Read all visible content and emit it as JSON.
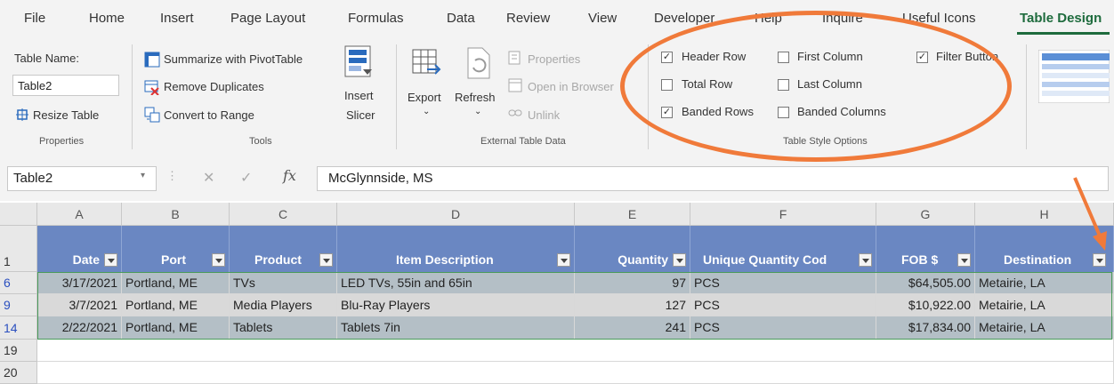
{
  "tabs": [
    "File",
    "Home",
    "Insert",
    "Page Layout",
    "Formulas",
    "Data",
    "Review",
    "View",
    "Developer",
    "Help",
    "Inquire",
    "Useful Icons",
    "Table Design"
  ],
  "ribbon": {
    "properties": {
      "table_name_label": "Table Name:",
      "table_name_value": "Table2",
      "resize": "Resize Table",
      "group": "Properties"
    },
    "tools": {
      "summarize": "Summarize with PivotTable",
      "remove_dups": "Remove Duplicates",
      "convert": "Convert to Range",
      "insert_slicer_1": "Insert",
      "insert_slicer_2": "Slicer",
      "group": "Tools"
    },
    "external": {
      "export": "Export",
      "refresh": "Refresh",
      "properties": "Properties",
      "open_browser": "Open in Browser",
      "unlink": "Unlink",
      "group": "External Table Data"
    },
    "style_options": {
      "header_row": "Header Row",
      "total_row": "Total Row",
      "banded_rows": "Banded Rows",
      "first_column": "First Column",
      "last_column": "Last Column",
      "banded_columns": "Banded Columns",
      "filter_button": "Filter Button",
      "group": "Table Style Options",
      "checks": {
        "header_row": true,
        "total_row": false,
        "banded_rows": true,
        "first_column": false,
        "last_column": false,
        "banded_columns": false,
        "filter_button": true
      }
    }
  },
  "formula_bar": {
    "name_box": "Table2",
    "fx": "fx",
    "value": "McGlynnside, MS"
  },
  "columns": [
    "A",
    "B",
    "C",
    "D",
    "E",
    "F",
    "G",
    "H"
  ],
  "headers": [
    "Date",
    "Port",
    "Product",
    "Item Description",
    "Quantity",
    "Unique Quantity Cod",
    "FOB $",
    "Destination"
  ],
  "row_numbers": [
    "1",
    "6",
    "9",
    "14",
    "19",
    "20"
  ],
  "rows": [
    [
      "3/17/2021",
      "Portland, ME",
      "TVs",
      "LED TVs, 55in and 65in",
      "97",
      "PCS",
      "$64,505.00",
      "Metairie, LA"
    ],
    [
      "3/7/2021",
      "Portland, ME",
      "Media Players",
      "Blu-Ray Players",
      "127",
      "PCS",
      "$10,922.00",
      "Metairie, LA"
    ],
    [
      "2/22/2021",
      "Portland, ME",
      "Tablets",
      "Tablets 7in",
      "241",
      "PCS",
      "$17,834.00",
      "Metairie, LA"
    ]
  ],
  "colors": {
    "header_fill": "#6a87c2",
    "band_fill": "#b4bfc6",
    "accent": "#1e6b3d",
    "annotation": "#f07a3a"
  }
}
